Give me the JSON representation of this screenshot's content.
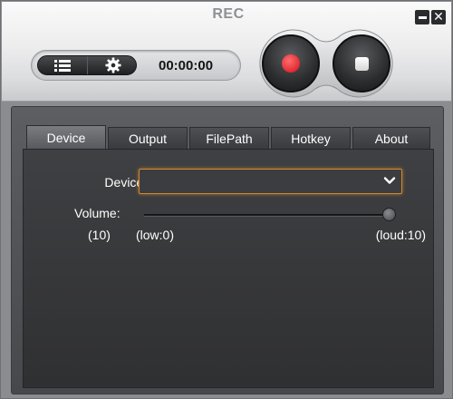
{
  "window": {
    "title": "REC"
  },
  "controls": {
    "list_icon": "list-icon",
    "settings_icon": "gear-icon",
    "timer": "00:00:00",
    "record_icon": "record-icon",
    "stop_icon": "stop-icon"
  },
  "tabs": [
    {
      "label": "Device",
      "active": true
    },
    {
      "label": "Output",
      "active": false
    },
    {
      "label": "FilePath",
      "active": false
    },
    {
      "label": "Hotkey",
      "active": false
    },
    {
      "label": "About",
      "active": false
    }
  ],
  "device_tab": {
    "device_label": "Device :",
    "device_value": "",
    "volume_label": "Volume:",
    "volume_value_text": "(10)",
    "volume_level": 10,
    "volume_min": 0,
    "volume_max": 10,
    "low_label": "(low:0)",
    "loud_label": "(loud:10)"
  },
  "colors": {
    "accent_focus": "#d08a2e",
    "record": "#d40f1a"
  }
}
